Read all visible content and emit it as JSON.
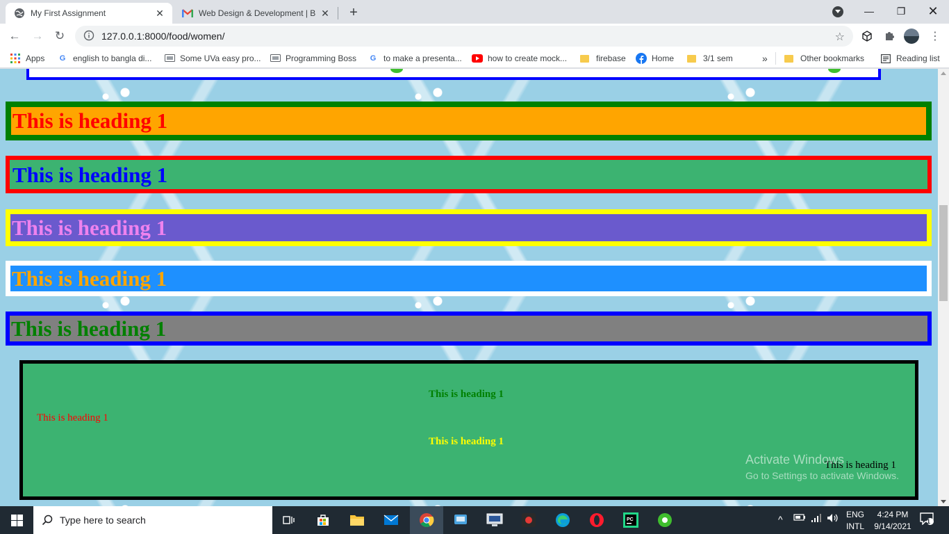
{
  "browser": {
    "tabs": [
      {
        "title": "My First Assignment",
        "active": true,
        "icon": "globe-icon"
      },
      {
        "title": "Web Design & Development | Ba",
        "active": false,
        "icon": "gmail-icon"
      }
    ],
    "url": "127.0.0.1:8000/food/women/",
    "bookmarks": [
      {
        "label": "Apps",
        "icon": "apps-grid-icon"
      },
      {
        "label": "english to bangla di...",
        "icon": "google-icon"
      },
      {
        "label": "Some UVa easy pro...",
        "icon": "site-icon"
      },
      {
        "label": "Programming Boss",
        "icon": "site-icon"
      },
      {
        "label": "to make a presenta...",
        "icon": "google-icon"
      },
      {
        "label": "how to create mock...",
        "icon": "youtube-icon"
      },
      {
        "label": "firebase",
        "icon": "folder-icon"
      },
      {
        "label": "Home",
        "icon": "facebook-icon"
      },
      {
        "label": "3/1 sem",
        "icon": "folder-icon"
      }
    ],
    "overflow_label": "»",
    "other_bookmarks": "Other bookmarks",
    "reading_list": "Reading list"
  },
  "page": {
    "headings": [
      {
        "text": "This is heading 1",
        "color": "#ff0000",
        "background": "#ffa500",
        "border": "#008000"
      },
      {
        "text": "This is heading 1",
        "color": "#0000ff",
        "background": "#3cb371",
        "border": "#ff0000"
      },
      {
        "text": "This is heading 1",
        "color": "#ee82ee",
        "background": "#6a5acd",
        "border": "#ffff00"
      },
      {
        "text": "This is heading 1",
        "color": "#ffa500",
        "background": "#1e90ff",
        "border": "#ffffff"
      },
      {
        "text": "This is heading 1",
        "color": "#008000",
        "background": "#808080",
        "border": "#0000ff"
      }
    ],
    "card": {
      "background": "#3cb371",
      "border": "#000000",
      "texts": [
        {
          "text": "This is heading 1",
          "color": "#008000",
          "bold": true
        },
        {
          "text": "This is heading 1",
          "color": "#ff0000",
          "bold": false
        },
        {
          "text": "This is heading 1",
          "color": "#ffff00",
          "bold": true
        },
        {
          "text": "This is heading 1",
          "color": "#000000",
          "bold": false
        }
      ]
    },
    "watermark": {
      "line1": "Activate Windows",
      "line2": "Go to Settings to activate Windows."
    }
  },
  "taskbar": {
    "search_placeholder": "Type here to search",
    "language": "ENG",
    "layout": "INTL",
    "time": "4:24 PM",
    "date": "9/14/2021",
    "notifications": "1"
  }
}
